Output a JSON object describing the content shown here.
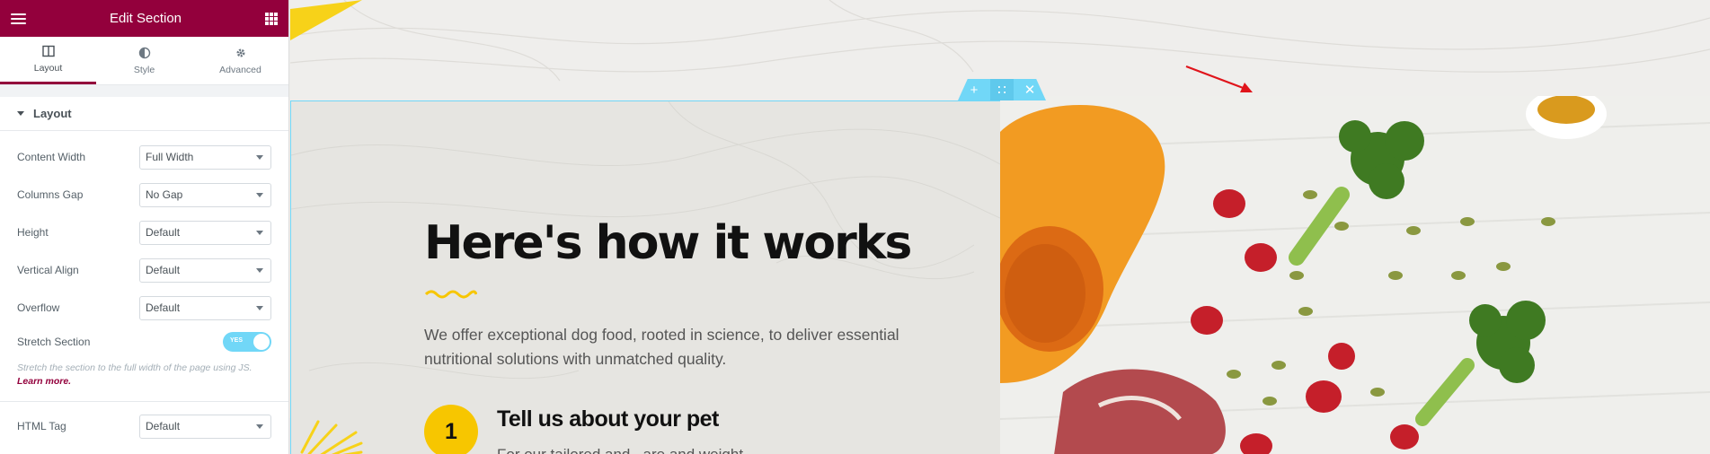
{
  "sidebar": {
    "title": "Edit Section",
    "tabs": [
      {
        "label": "Layout",
        "icon": "columns-icon",
        "active": true
      },
      {
        "label": "Style",
        "icon": "half-circle-icon",
        "active": false
      },
      {
        "label": "Advanced",
        "icon": "gear-icon",
        "active": false
      }
    ],
    "section_heading": "Layout",
    "controls": {
      "content_width": {
        "label": "Content Width",
        "value": "Full Width"
      },
      "columns_gap": {
        "label": "Columns Gap",
        "value": "No Gap"
      },
      "height": {
        "label": "Height",
        "value": "Default"
      },
      "vertical_align": {
        "label": "Vertical Align",
        "value": "Default"
      },
      "overflow": {
        "label": "Overflow",
        "value": "Default"
      },
      "stretch_section": {
        "label": "Stretch Section",
        "toggle_text": "YES",
        "enabled": true
      },
      "html_tag": {
        "label": "HTML Tag",
        "value": "Default"
      }
    },
    "stretch_description": "Stretch the section to the full width of the page using JS.",
    "learn_more": "Learn more."
  },
  "canvas": {
    "section_handle": {
      "add": "+",
      "move": "∷",
      "close": "✕"
    },
    "headline": "Here's how it works",
    "intro": "We offer exceptional dog food, rooted in science, to deliver essential nutritional solutions with unmatched quality.",
    "step": {
      "number": "1",
      "title": "Tell us about your pet",
      "text": "For our tailored and...are and weight..."
    }
  },
  "colors": {
    "brand": "#93003c",
    "selection": "#71d7f7",
    "accent_yellow": "#f7c600"
  }
}
